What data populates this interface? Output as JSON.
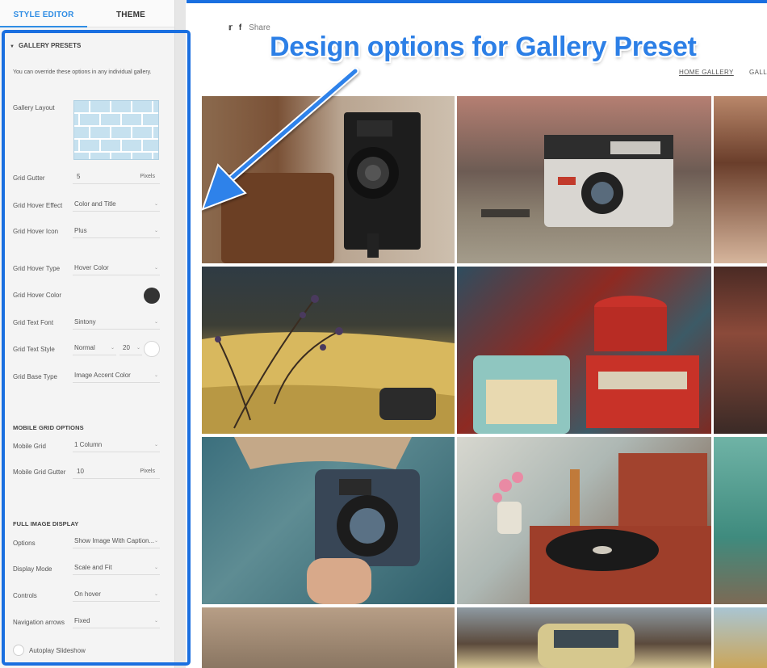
{
  "tabs": {
    "style_editor": "STYLE EDITOR",
    "theme": "THEME"
  },
  "panel": {
    "section_title": "GALLERY PRESETS",
    "intro": "You can override these options in any individual gallery.",
    "gallery_layout_label": "Gallery Layout",
    "grid_gutter": {
      "label": "Grid Gutter",
      "value": "5",
      "unit": "Pixels"
    },
    "grid_hover_effect": {
      "label": "Grid Hover Effect",
      "value": "Color and Title"
    },
    "grid_hover_icon": {
      "label": "Grid Hover Icon",
      "value": "Plus"
    },
    "grid_hover_type": {
      "label": "Grid Hover Type",
      "value": "Hover Color"
    },
    "grid_hover_color": {
      "label": "Grid Hover Color",
      "color": "#333333"
    },
    "grid_text_font": {
      "label": "Grid Text Font",
      "value": "Sintony"
    },
    "grid_text_style": {
      "label": "Grid Text Style",
      "value": "Normal",
      "size": "20",
      "color": "#ffffff"
    },
    "grid_base_type": {
      "label": "Grid Base Type",
      "value": "Image Accent Color"
    },
    "mobile_heading": "MOBILE GRID OPTIONS",
    "mobile_grid": {
      "label": "Mobile Grid",
      "value": "1 Column"
    },
    "mobile_grid_gutter": {
      "label": "Mobile Grid Gutter",
      "value": "10",
      "unit": "Pixels"
    },
    "full_image_heading": "FULL IMAGE DISPLAY",
    "options": {
      "label": "Options",
      "value": "Show Image With Caption..."
    },
    "display_mode": {
      "label": "Display Mode",
      "value": "Scale and Fit"
    },
    "controls": {
      "label": "Controls",
      "value": "On hover"
    },
    "navigation_arrows": {
      "label": "Navigation arrows",
      "value": "Fixed"
    },
    "autoplay": {
      "label": "Autoplay Slideshow"
    }
  },
  "preview": {
    "share_label": "Share",
    "nav_home": "HOME GALLERY",
    "nav_gallery": "GALLERY"
  },
  "annotation": "Design options for Gallery Preset",
  "icons": [
    "twitter-icon",
    "facebook-icon",
    "caret-down-icon"
  ],
  "colors": {
    "accent": "#2f8de4",
    "annotation": "#2c7fe6",
    "highlight_border": "#1a6fe0"
  },
  "gallery_images": [
    "vintage folding camera on leather case",
    "Instamatic camera on wooden table",
    "partial photo",
    "yellow vintage car with dried flowers",
    "stacked vintage tins",
    "vintage car interior",
    "person photographing with instant camera",
    "record player with telephone and flowers",
    "vintage fuel pump",
    "partial photo",
    "vintage car on street",
    "partial photo"
  ]
}
